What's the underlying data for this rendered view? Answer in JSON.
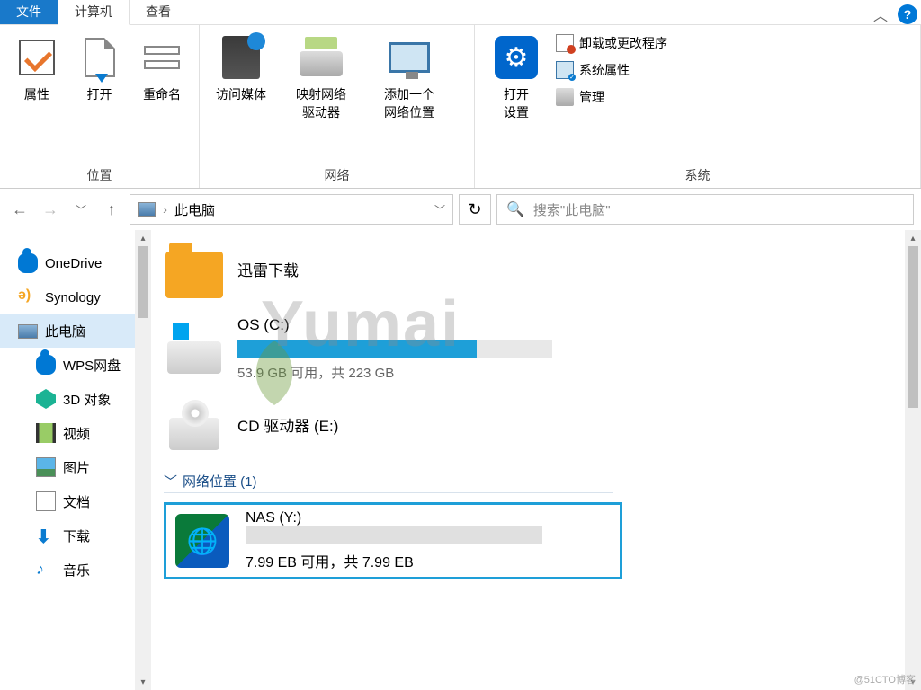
{
  "tabs": {
    "file": "文件",
    "computer": "计算机",
    "view": "查看"
  },
  "ribbon": {
    "group_location": "位置",
    "group_network": "网络",
    "group_system": "系统",
    "properties": "属性",
    "open": "打开",
    "rename": "重命名",
    "access_media": "访问媒体",
    "map_drive": "映射网络\n驱动器",
    "add_netloc": "添加一个\n网络位置",
    "open_settings": "打开\n设置",
    "uninstall": "卸载或更改程序",
    "sys_props": "系统属性",
    "manage": "管理"
  },
  "nav": {
    "breadcrumb": "此电脑",
    "search_placeholder": "搜索\"此电脑\""
  },
  "tree": {
    "onedrive": "OneDrive",
    "synology": "Synology",
    "thispc": "此电脑",
    "wps": "WPS网盘",
    "3d": "3D 对象",
    "video": "视频",
    "pictures": "图片",
    "docs": "文档",
    "downloads": "下载",
    "music": "音乐"
  },
  "content": {
    "xunlei": "迅雷下载",
    "os_c": {
      "title": "OS (C:)",
      "sub": "53.9 GB 可用，共 223 GB",
      "used_pct": 76
    },
    "cd_e": {
      "title": "CD 驱动器 (E:)"
    },
    "netloc_header": "网络位置 (1)",
    "nas_y": {
      "title": "NAS (Y:)",
      "sub": "7.99 EB 可用，共 7.99 EB",
      "used_pct": 0
    }
  },
  "watermark": "Yumai",
  "credit": "@51CTO博客"
}
